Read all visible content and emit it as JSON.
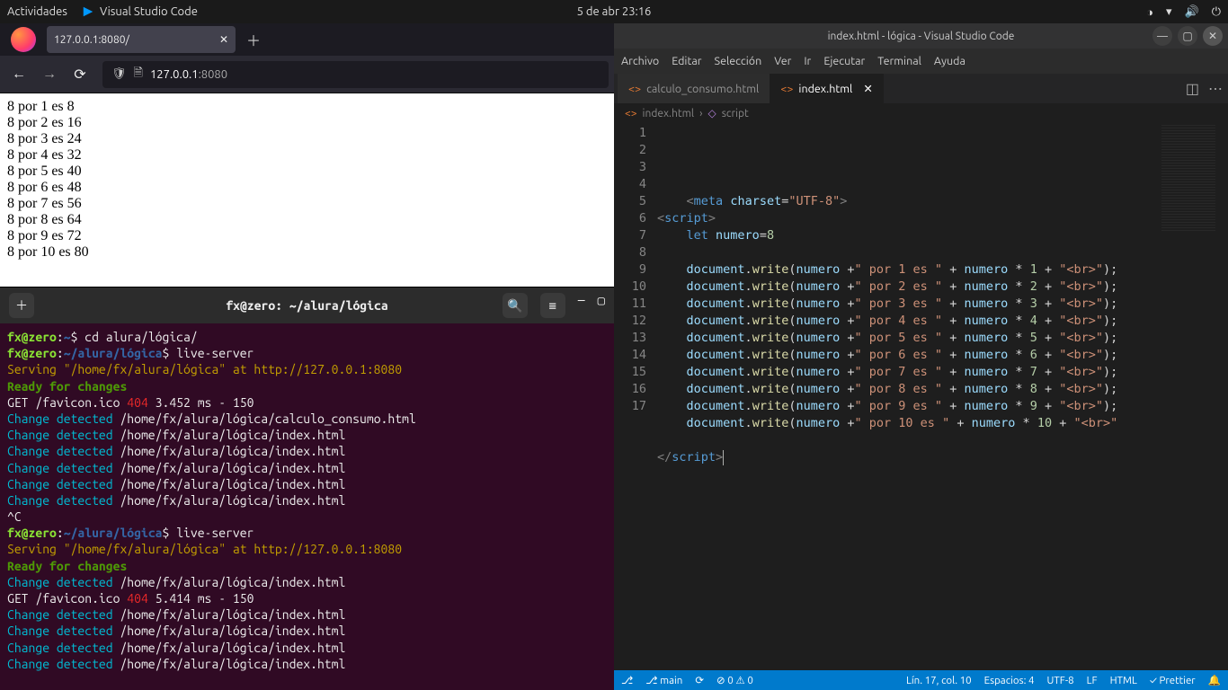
{
  "topbar": {
    "activities": "Actividades",
    "appname": "Visual Studio Code",
    "clock": "5 de abr  23:16"
  },
  "firefox": {
    "tab_title": "127.0.0.1:8080/",
    "url_host": "127.0.0.1",
    "url_path": ":8080",
    "page_lines": [
      "8 por 1 es 8",
      "8 por 2 es 16",
      "8 por 3 es 24",
      "8 por 4 es 32",
      "8 por 5 es 40",
      "8 por 6 es 48",
      "8 por 7 es 56",
      "8 por 8 es 64",
      "8 por 9 es 72",
      "8 por 10 es 80"
    ]
  },
  "terminal": {
    "title": "fx@zero: ~/alura/lógica",
    "lines": [
      {
        "segs": [
          {
            "t": "fx@zero",
            "c": "t-green-b"
          },
          {
            "t": ":",
            "c": "t-white"
          },
          {
            "t": "~",
            "c": "t-blue"
          },
          {
            "t": "$ ",
            "c": "t-white"
          },
          {
            "t": "cd alura/lógica/",
            "c": "t-white"
          }
        ]
      },
      {
        "segs": [
          {
            "t": "fx@zero",
            "c": "t-green-b"
          },
          {
            "t": ":",
            "c": "t-white"
          },
          {
            "t": "~/alura/lógica",
            "c": "t-blue"
          },
          {
            "t": "$ ",
            "c": "t-white"
          },
          {
            "t": "live-server",
            "c": "t-white"
          }
        ]
      },
      {
        "segs": [
          {
            "t": "Serving \"/home/fx/alura/lógica\" at http://127.0.0.1:8080",
            "c": "t-orange"
          }
        ]
      },
      {
        "segs": [
          {
            "t": "Ready for changes",
            "c": "t-green"
          }
        ]
      },
      {
        "segs": [
          {
            "t": "GET /favicon.ico ",
            "c": "t-white"
          },
          {
            "t": "404",
            "c": "t-red"
          },
          {
            "t": " 3.452 ms - 150",
            "c": "t-white"
          }
        ]
      },
      {
        "segs": [
          {
            "t": "Change detected",
            "c": "t-cyan"
          },
          {
            "t": " /home/fx/alura/lógica/calculo_consumo.html",
            "c": "t-white"
          }
        ]
      },
      {
        "segs": [
          {
            "t": "Change detected",
            "c": "t-cyan"
          },
          {
            "t": " /home/fx/alura/lógica/index.html",
            "c": "t-white"
          }
        ]
      },
      {
        "segs": [
          {
            "t": "Change detected",
            "c": "t-cyan"
          },
          {
            "t": " /home/fx/alura/lógica/index.html",
            "c": "t-white"
          }
        ]
      },
      {
        "segs": [
          {
            "t": "Change detected",
            "c": "t-cyan"
          },
          {
            "t": " /home/fx/alura/lógica/index.html",
            "c": "t-white"
          }
        ]
      },
      {
        "segs": [
          {
            "t": "Change detected",
            "c": "t-cyan"
          },
          {
            "t": " /home/fx/alura/lógica/index.html",
            "c": "t-white"
          }
        ]
      },
      {
        "segs": [
          {
            "t": "Change detected",
            "c": "t-cyan"
          },
          {
            "t": " /home/fx/alura/lógica/index.html",
            "c": "t-white"
          }
        ]
      },
      {
        "segs": [
          {
            "t": "^C",
            "c": "t-white"
          }
        ]
      },
      {
        "segs": [
          {
            "t": "fx@zero",
            "c": "t-green-b"
          },
          {
            "t": ":",
            "c": "t-white"
          },
          {
            "t": "~/alura/lógica",
            "c": "t-blue"
          },
          {
            "t": "$ ",
            "c": "t-white"
          },
          {
            "t": "live-server",
            "c": "t-white"
          }
        ]
      },
      {
        "segs": [
          {
            "t": "Serving \"/home/fx/alura/lógica\" at http://127.0.0.1:8080",
            "c": "t-orange"
          }
        ]
      },
      {
        "segs": [
          {
            "t": "Ready for changes",
            "c": "t-green"
          }
        ]
      },
      {
        "segs": [
          {
            "t": "Change detected",
            "c": "t-cyan"
          },
          {
            "t": " /home/fx/alura/lógica/index.html",
            "c": "t-white"
          }
        ]
      },
      {
        "segs": [
          {
            "t": "GET /favicon.ico ",
            "c": "t-white"
          },
          {
            "t": "404",
            "c": "t-red"
          },
          {
            "t": " 5.414 ms - 150",
            "c": "t-white"
          }
        ]
      },
      {
        "segs": [
          {
            "t": "Change detected",
            "c": "t-cyan"
          },
          {
            "t": " /home/fx/alura/lógica/index.html",
            "c": "t-white"
          }
        ]
      },
      {
        "segs": [
          {
            "t": "Change detected",
            "c": "t-cyan"
          },
          {
            "t": " /home/fx/alura/lógica/index.html",
            "c": "t-white"
          }
        ]
      },
      {
        "segs": [
          {
            "t": "Change detected",
            "c": "t-cyan"
          },
          {
            "t": " /home/fx/alura/lógica/index.html",
            "c": "t-white"
          }
        ]
      },
      {
        "segs": [
          {
            "t": "Change detected",
            "c": "t-cyan"
          },
          {
            "t": " /home/fx/alura/lógica/index.html",
            "c": "t-white"
          }
        ]
      }
    ]
  },
  "vscode": {
    "title": "index.html - lógica - Visual Studio Code",
    "menu": [
      "Archivo",
      "Editar",
      "Selección",
      "Ver",
      "Ir",
      "Ejecutar",
      "Terminal",
      "Ayuda"
    ],
    "tabs": [
      {
        "name": "calculo_consumo.html",
        "active": false
      },
      {
        "name": "index.html",
        "active": true
      }
    ],
    "breadcrumb": [
      "index.html",
      "script"
    ],
    "status": {
      "branch": "main",
      "sync": "",
      "errors": "0",
      "warnings": "0",
      "pos": "Lín. 17, col. 10",
      "spaces": "Espacios: 4",
      "encoding": "UTF-8",
      "eol": "LF",
      "lang": "HTML",
      "prettier": "Prettier"
    },
    "code": {
      "line1_indent": "    ",
      "line2_open": "<",
      "line2_elem": "script",
      "line2_close": ">",
      "line4_let": "let",
      "line4_var": "numero",
      "line4_eq": "=",
      "line4_val": "8",
      "write_lines": [
        {
          "n": "1"
        },
        {
          "n": "2"
        },
        {
          "n": "3"
        },
        {
          "n": "4"
        },
        {
          "n": "5"
        },
        {
          "n": "6"
        },
        {
          "n": "7"
        },
        {
          "n": "8"
        },
        {
          "n": "9"
        }
      ],
      "last_n": "10",
      "meta_elem": "meta",
      "meta_attr": "charset",
      "meta_val": "\"UTF-8\"",
      "doc": "document",
      "write": "write",
      "numero": "numero",
      "por_prefix": "\" por ",
      "es_suffix": " es \"",
      "br": "\"<br>\"",
      "por10": "\" por 10 es \"",
      "endscript_open": "</",
      "endscript_elem": "script",
      "endscript_close": ">"
    }
  }
}
